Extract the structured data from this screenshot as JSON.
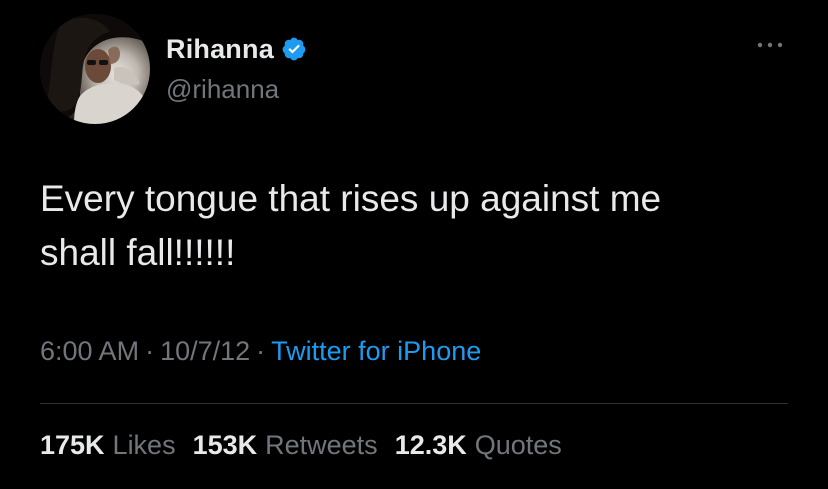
{
  "author": {
    "display_name": "Rihanna",
    "handle": "@rihanna",
    "verified": true,
    "verified_color": "#1d9bf0"
  },
  "tweet": {
    "text": "Every tongue that rises up against me\nshall fall!!!!!!"
  },
  "meta": {
    "time": "6:00 AM",
    "separator": "·",
    "date": "10/7/12",
    "source": "Twitter for iPhone"
  },
  "stats": [
    {
      "value": "175K",
      "label": "Likes"
    },
    {
      "value": "153K",
      "label": "Retweets"
    },
    {
      "value": "12.3K",
      "label": "Quotes"
    }
  ],
  "icons": {
    "more": "more-options-icon",
    "verified": "verified-badge-icon"
  },
  "colors": {
    "background": "#000000",
    "text": "#e7e9ea",
    "muted": "#71767b",
    "accent": "#1d9bf0"
  }
}
